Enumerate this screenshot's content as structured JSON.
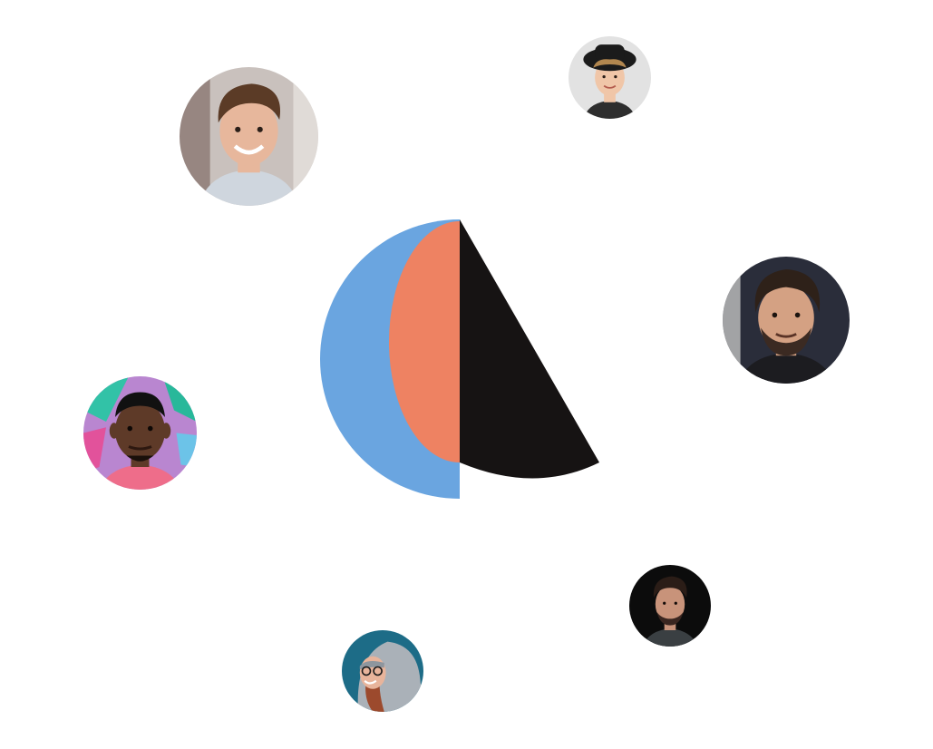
{
  "brand": {
    "logo_icon": "abstract-half-moon-logo-icon",
    "colors": {
      "blue": "#6aa5e0",
      "coral": "#ee8262",
      "dark": "#161313",
      "background": "#ffffff"
    }
  },
  "avatars": [
    {
      "name": "avatar-man-brown-hair-smiling",
      "icon": "person-photo-icon",
      "skin": "#e7b79c",
      "hair": "#5b3b26",
      "bg": "#c9c1bd",
      "shirt": "#cfd6de"
    },
    {
      "name": "avatar-man-black-hat",
      "icon": "person-photo-icon",
      "skin": "#f0c6a8",
      "hair": "#b2874f",
      "bg": "#e2e2e2",
      "shirt": "#2e2e2e"
    },
    {
      "name": "avatar-man-beard-dark-hair",
      "icon": "person-photo-icon",
      "skin": "#d4a183",
      "hair": "#2e2119",
      "bg": "#2a2d3a",
      "shirt": "#1c1c20"
    },
    {
      "name": "avatar-man-graffiti-background",
      "icon": "person-photo-icon",
      "skin": "#5e3a28",
      "hair": "#111111",
      "bg": "#b986d0",
      "shirt": "#ee6d8a"
    },
    {
      "name": "avatar-man-dark-background",
      "icon": "person-photo-icon",
      "skin": "#c8937a",
      "hair": "#2b1d17",
      "bg": "#0c0c0c",
      "shirt": "#3a3f42"
    },
    {
      "name": "avatar-woman-grey-hood",
      "icon": "person-photo-icon",
      "skin": "#e8b49b",
      "hair": "#9c4a2d",
      "bg": "#1d6c87",
      "shirt": "#aab1b8"
    }
  ]
}
